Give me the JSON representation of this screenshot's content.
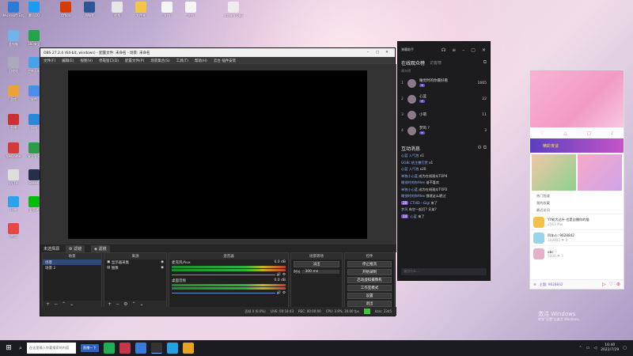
{
  "desktop": {
    "icons": [
      {
        "label": "Microsoft Edge",
        "color": "#2a7bd6"
      },
      {
        "label": "腾讯QQ",
        "color": "#1e9bf0"
      },
      {
        "label": "Office",
        "color": "#d83b01"
      },
      {
        "label": "Word",
        "color": "#2b5797"
      },
      {
        "label": "视频",
        "color": "#e6e6e6"
      },
      {
        "label": "文件夹",
        "color": "#f4c542"
      },
      {
        "label": "文档",
        "color": "#f5f5f5"
      },
      {
        "label": "文档",
        "color": "#f5f5f5"
      },
      {
        "label": "stream OBS",
        "color": "#ececec"
      },
      {
        "label": "此电脑",
        "color": "#6fb3e8"
      },
      {
        "label": "360安全",
        "color": "#22a24b"
      },
      {
        "label": "回收站",
        "color": "#aab"
      },
      {
        "label": "控制面板",
        "color": "#4aa1e8"
      },
      {
        "label": "游戏",
        "color": "#e8a43a"
      },
      {
        "label": "软件",
        "color": "#4a8ee8"
      },
      {
        "label": "直播",
        "color": "#c83232"
      },
      {
        "label": "网络",
        "color": "#2c87d8"
      },
      {
        "label": "WeGame",
        "color": "#d43a3a"
      },
      {
        "label": "安全管家",
        "color": "#2f9b4a"
      },
      {
        "label": "CCTV",
        "color": "#ddd"
      },
      {
        "label": "Steam",
        "color": "#24304a"
      },
      {
        "label": "迅雷",
        "color": "#2ea1ea"
      },
      {
        "label": "爱奇艺",
        "color": "#00be06"
      },
      {
        "label": "音乐",
        "color": "#e84545"
      }
    ]
  },
  "obs": {
    "title": "OBS 27.2.4 (64-bit, windows) - 配置文件: 未命名 - 场景: 未命名",
    "menu": [
      "文件(F)",
      "编辑(E)",
      "视图(V)",
      "停靠窗口(D)",
      "配置文件(P)",
      "场景集合(S)",
      "工具(T)",
      "帮助(H)",
      "云台 插件安装"
    ],
    "dock_tabs": [
      "滤镜",
      "滤镜"
    ],
    "dock_label": "未选择源",
    "scenes": {
      "title": "场景",
      "items": [
        "场景",
        "场景 2"
      ]
    },
    "sources": {
      "title": "来源",
      "items": [
        "显示器采集",
        "图像"
      ]
    },
    "mixer": {
      "title": "混音器",
      "tracks": [
        {
          "name": "麦克风/Aux",
          "db": "0.0 dB"
        },
        {
          "name": "桌面音频",
          "db": "0.0 dB"
        }
      ]
    },
    "transitions": {
      "title": "场景转场",
      "type": "淡出",
      "duration_label": "时长",
      "duration": "300 ms"
    },
    "controls": {
      "title": "控件",
      "buttons": [
        "停止推流",
        "开始录制",
        "启动虚拟摄像机",
        "工作室模式",
        "设置",
        "退出"
      ]
    },
    "status": {
      "dropped": "丢帧 0 (0.0%)",
      "live": "LIVE: 00:18:43",
      "rec": "REC: 00:00:00",
      "cpu": "CPU: 3.9%, 30.00 fps",
      "kbps": "kb/s: 2345"
    }
  },
  "live": {
    "title": "弹幕助手",
    "online": {
      "label": "在线观众榜",
      "sub": "访客榜"
    },
    "rank_hdr": "观众榜",
    "ranks": [
      {
        "num": "1",
        "name": "睡觉时的你最好看",
        "score": "1665"
      },
      {
        "num": "2",
        "name": "心蓝",
        "score": "22"
      },
      {
        "num": "3",
        "name": "小萌",
        "score": "11"
      },
      {
        "num": "4",
        "name": "梦风 ?",
        "score": "3"
      }
    ],
    "chat_title": "互动消息",
    "messages": [
      {
        "pill": "",
        "user": "心蓝 入气泡",
        "text": "x1"
      },
      {
        "pill": "",
        "user": "GG8c 给主播打赏",
        "text": "x1"
      },
      {
        "pill": "",
        "user": "心蓝 入气泡",
        "text": "x20"
      },
      {
        "pill": "",
        "user": "单独小心蓝",
        "text": "成为在线观众TOP4"
      },
      {
        "pill": "",
        "user": "睡觉时的你Alex",
        "text": "谁不喜欢"
      },
      {
        "pill": "",
        "user": "单独小心蓝",
        "text": "成为在线观众TOP2"
      },
      {
        "pill": "",
        "user": "睡觉时的你Alex",
        "text": "俄就这么晒过"
      },
      {
        "pill": "20",
        "user": "CTHD---Gigi",
        "text": "来了"
      },
      {
        "pill": "",
        "user": "梦风",
        "text": "有空一起打? 兄弟?"
      },
      {
        "pill": "14",
        "user": "心蓝",
        "text": "来了"
      }
    ],
    "input_placeholder": "说点什么..."
  },
  "phone": {
    "tabs": [
      "♡",
      "△",
      "▢",
      "♪"
    ],
    "promo": "精彩夜谈",
    "menu": [
      "热门频道",
      "我的收藏",
      "最近访问"
    ],
    "feed": [
      {
        "title": "YY能大达什 也是自播你的猫",
        "sub": "2563 Mw"
      },
      {
        "title": "四年心: 9628842",
        "sub": "169903  ⚑ 3"
      },
      {
        "title": "abc",
        "sub": "5000 ⚑ 3"
      }
    ],
    "bottom": "主题: 9628842"
  },
  "taskbar": {
    "search": "在这里输入你要搜索的内容",
    "pinned": "直播一下",
    "clock_time": "16:40",
    "clock_date": "2022/7/29"
  },
  "watermark": {
    "title": "激活 Windows",
    "sub": "转到\"设置\"以激活 Windows。"
  }
}
